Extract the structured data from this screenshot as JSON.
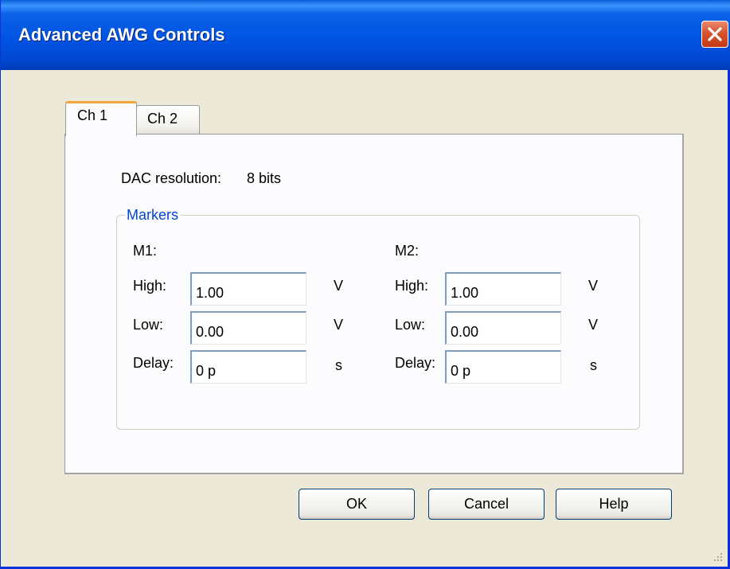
{
  "window": {
    "title": "Advanced AWG Controls",
    "close_icon": "close-icon",
    "colors": {
      "titlebar": "#0054e3",
      "close_button": "#d7532e",
      "dialog_bg": "#ece9d8",
      "panel_bg": "#fcfcfe",
      "group_legend": "#0046d5",
      "active_tab_accent": "#f3a43b"
    }
  },
  "tabs": [
    {
      "label": "Ch 1",
      "selected": true
    },
    {
      "label": "Ch 2",
      "selected": false
    }
  ],
  "panel": {
    "dac_label": "DAC resolution:",
    "dac_value": "8 bits",
    "markers": {
      "legend": "Markers",
      "m1": {
        "title": "M1:",
        "high_label": "High:",
        "high_value": "1.00",
        "high_unit": "V",
        "low_label": "Low:",
        "low_value": "0.00",
        "low_unit": "V",
        "delay_label": "Delay:",
        "delay_value": "0 p",
        "delay_unit": "s"
      },
      "m2": {
        "title": "M2:",
        "high_label": "High:",
        "high_value": "1.00",
        "high_unit": "V",
        "low_label": "Low:",
        "low_value": "0.00",
        "low_unit": "V",
        "delay_label": "Delay:",
        "delay_value": "0 p",
        "delay_unit": "s"
      }
    }
  },
  "buttons": {
    "ok": "OK",
    "cancel": "Cancel",
    "help": "Help"
  }
}
